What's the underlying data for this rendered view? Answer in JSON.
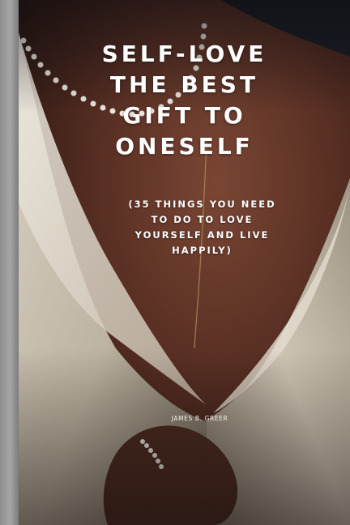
{
  "book": {
    "title_lines": [
      "SELF-LOVE",
      "THE BEST",
      "GIFT TO",
      "ONESELF"
    ],
    "subtitle_lines": [
      "(35 THINGS YOU NEED",
      "TO DO TO LOVE",
      "YOURSELF AND LIVE",
      "HAPPILY)"
    ],
    "author": "JAMES B. GREER"
  },
  "colors": {
    "title_text": "#ffffff",
    "background_dark": "#2b1a16",
    "blazer": "#cfc6b7",
    "skin": "#6b3d2e",
    "page_edge": "#a6a6a6"
  }
}
